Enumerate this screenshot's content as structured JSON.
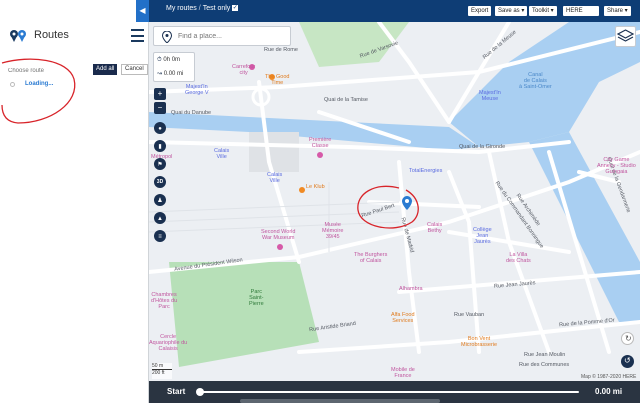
{
  "left_panel": {
    "title": "Routes",
    "route_input_placeholder": "Choose route",
    "add_all_label": "Add all",
    "cancel_label": "Cancel",
    "loading_text": "Loading..."
  },
  "topbar": {
    "back_icon": "chevron-left-icon",
    "breadcrumb_root": "My routes",
    "breadcrumb_sep": "/",
    "breadcrumb_current": "Test only",
    "checkbox_mark": "✓",
    "export_label": "Export",
    "save_as_label": "Save as ▾",
    "toolkit_label": "Toolkit ▾",
    "map_provider_label": "HERE",
    "share_label": "Share ▾"
  },
  "map": {
    "search_placeholder": "Find a place...",
    "time_readout": "0h 0m",
    "distance_readout": "0.00 mi",
    "zoom_in": "+",
    "zoom_out": "−",
    "btn_3d": "3D",
    "scale_top": "50 m",
    "scale_bottom": "200 ft",
    "copyright": "Map © 1987-2020 HERE",
    "streets": [
      "Rue de Rome",
      "Rue de Varsovie",
      "Rue de la Meuse",
      "Quai de la Tamise",
      "Quai du Danube",
      "Quai de la Gironde",
      "Rue Paul Bert",
      "Avenue du Président Wilson",
      "Rue Aristide Briand",
      "Rue Jean Jaurès",
      "Rue Vauban",
      "Rue de la Pomme d'Or",
      "Rue Jean Moulin",
      "Rue des Communes",
      "Quai de la Gendarmerie",
      "Rue du Commandant Bonningue",
      "Rue Archimède",
      "Rue de Madrid"
    ],
    "pois": {
      "carrefour": "Carrefour\ncity",
      "good_time": "The Good\nTime",
      "majestic_george": "Majest'In\nGeorge V",
      "majestic_meuse": "Majest'In\nMeuse",
      "canal": "Canal\nde Calais\nà Saint-Omer",
      "premiere_classe": "Première\nClasse",
      "calais_ville": "Calais\nVille",
      "calais_ville2": "Calais\nVille",
      "totalenergies": "TotalEnergies",
      "le_klub": "Le Klub",
      "city_game": "City Game\nAnnecy - Studio\nGuingaia",
      "ww2_museum": "Second World\nWar Museum",
      "musee_memoire": "Musée\nMémoire\n39/45",
      "burghers": "The Burghers\nof Calais",
      "calais_bethy": "Calais\nBethy",
      "college": "Collège\nJean\nJaurès",
      "villa_chats": "La Villa\ndes Chats",
      "parc": "Parc\nSaint-\nPierre",
      "chambres": "Chambres\nd'Hôtes du\nParc",
      "cercle": "Cercle\nAquariophile du\nCalaisis",
      "alhambra": "Alhambra",
      "alfa_food": "Alfa Food\nServices",
      "bon_vent": "Bon Vent\nMicrobrasserie",
      "mobile_de_france": "Mobile de\nFrance",
      "metropol": "Métropol"
    },
    "colors": {
      "water": "#a9cff2",
      "park": "#b7e0b8",
      "road": "#ffffff",
      "land": "#eceff3",
      "annotation": "#d8242a"
    }
  },
  "bottombar": {
    "start_label": "Start",
    "distance_label": "0.00 mi",
    "progress": 0.0
  }
}
